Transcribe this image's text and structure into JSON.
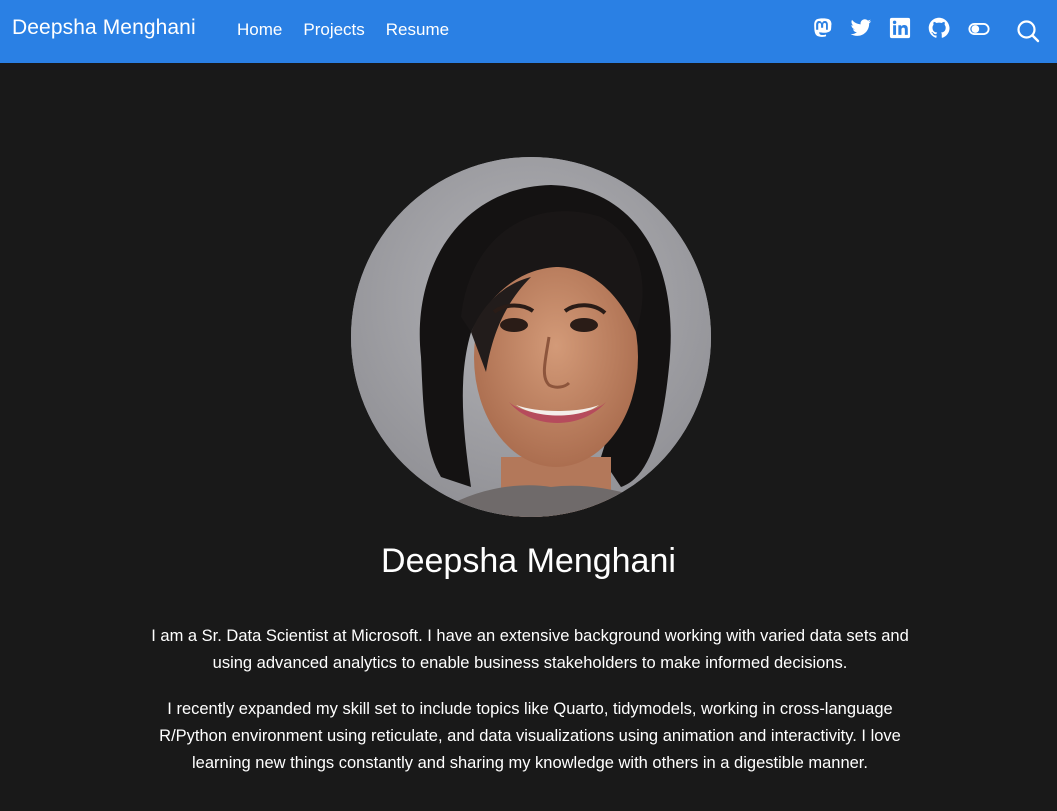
{
  "navbar": {
    "brand": "Deepsha Menghani",
    "links": [
      "Home",
      "Projects",
      "Resume"
    ],
    "icons": [
      "mastodon-icon",
      "twitter-icon",
      "linkedin-icon",
      "github-icon",
      "toggle-icon",
      "search-icon"
    ],
    "background_color": "#2a80e4"
  },
  "profile": {
    "name": "Deepsha Menghani",
    "bio": [
      "I am a Sr. Data Scientist at Microsoft. I have an extensive background working with varied data sets and using advanced analytics to enable business stakeholders to make informed decisions.",
      "I recently expanded my skill set to include topics like Quarto, tidymodels, working in cross-language R/Python environment using reticulate, and data visualizations using animation and interactivity. I love learning new things constantly and sharing my knowledge with others in a digestible manner."
    ]
  },
  "page": {
    "background_color": "#191919"
  }
}
